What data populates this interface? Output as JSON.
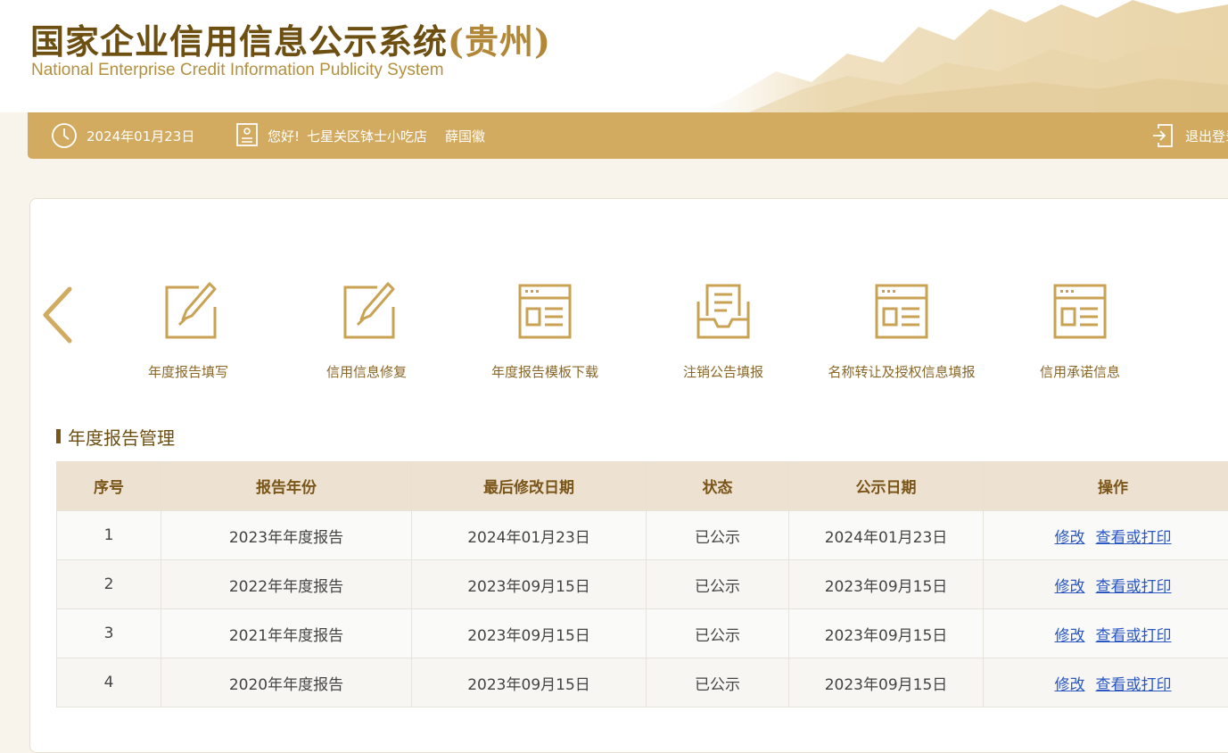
{
  "header": {
    "title_main": "国家企业信用信息公示系统",
    "title_province": "(贵州)",
    "subtitle": "National Enterprise Credit Information Publicity System"
  },
  "topbar": {
    "date": "2024年01月23日",
    "greeting": "您好!",
    "company": "七星关区钵士小吃店",
    "person": "薛国徽",
    "logout_label": "退出登录"
  },
  "quick_menu": {
    "items": [
      {
        "label": "年度报告填写",
        "icon": "edit-icon"
      },
      {
        "label": "信用信息修复",
        "icon": "edit-icon"
      },
      {
        "label": "年度报告模板下载",
        "icon": "template-icon"
      },
      {
        "label": "注销公告填报",
        "icon": "inbox-document-icon"
      },
      {
        "label": "名称转让及授权信息填报",
        "icon": "template-icon"
      },
      {
        "label": "信用承诺信息",
        "icon": "template-icon"
      }
    ]
  },
  "section": {
    "title": "年度报告管理"
  },
  "table": {
    "headers": [
      "序号",
      "报告年份",
      "最后修改日期",
      "状态",
      "公示日期",
      "操作"
    ],
    "rows": [
      {
        "no": "1",
        "year": "2023年年度报告",
        "modified": "2024年01月23日",
        "status": "已公示",
        "publish": "2024年01月23日",
        "edit": "修改",
        "view": "查看或打印"
      },
      {
        "no": "2",
        "year": "2022年年度报告",
        "modified": "2023年09月15日",
        "status": "已公示",
        "publish": "2023年09月15日",
        "edit": "修改",
        "view": "查看或打印"
      },
      {
        "no": "3",
        "year": "2021年年度报告",
        "modified": "2023年09月15日",
        "status": "已公示",
        "publish": "2023年09月15日",
        "edit": "修改",
        "view": "查看或打印"
      },
      {
        "no": "4",
        "year": "2020年年度报告",
        "modified": "2023年09月15日",
        "status": "已公示",
        "publish": "2023年09月15日",
        "edit": "修改",
        "view": "查看或打印"
      }
    ]
  },
  "colors": {
    "accent_gold": "#d2ab60",
    "title_brown": "#6e4f12",
    "icon_gold": "#c9a253",
    "link_blue": "#2a57c2"
  }
}
